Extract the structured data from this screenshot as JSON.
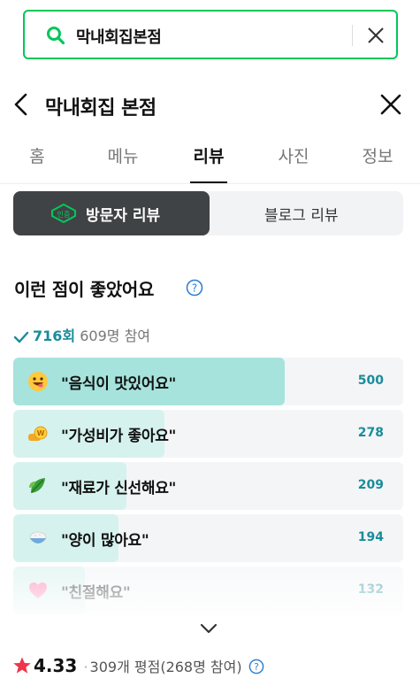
{
  "search": {
    "query": "막내회집본점"
  },
  "header": {
    "title": "막내회집 본점"
  },
  "tabs": [
    {
      "label": "홈"
    },
    {
      "label": "메뉴"
    },
    {
      "label": "리뷰"
    },
    {
      "label": "사진"
    },
    {
      "label": "정보"
    }
  ],
  "active_tab": "리뷰",
  "review_toggle": {
    "badge": "인증",
    "active_label": "방문자 리뷰",
    "other_label": "블로그 리뷰"
  },
  "keywords_section": {
    "title": "이런 점이 좋았어요",
    "total_count": "716회",
    "participants": "609명 참여",
    "items": [
      {
        "label": "\"음식이 맛있어요\"",
        "count": "500",
        "icon": "yummy-face-icon",
        "fraction": 1.0
      },
      {
        "label": "\"가성비가 좋아요\"",
        "count": "278",
        "icon": "money-icon",
        "fraction": 0.556
      },
      {
        "label": "\"재료가 신선해요\"",
        "count": "209",
        "icon": "leaf-icon",
        "fraction": 0.418
      },
      {
        "label": "\"양이 많아요\"",
        "count": "194",
        "icon": "rice-bowl-icon",
        "fraction": 0.388
      },
      {
        "label": "\"친절해요\"",
        "count": "132",
        "icon": "heart-icon",
        "fraction": 0.264
      }
    ]
  },
  "rating": {
    "value": "4.33",
    "dot": "·",
    "summary": "309개 평점(268명 참여)"
  },
  "colors": {
    "accent_green": "#03c75a",
    "fill_strong": "#a6e3dc",
    "fill_light": "#d6f2ee",
    "count_teal": "#1a8c9a",
    "star_red": "#f0344b"
  }
}
